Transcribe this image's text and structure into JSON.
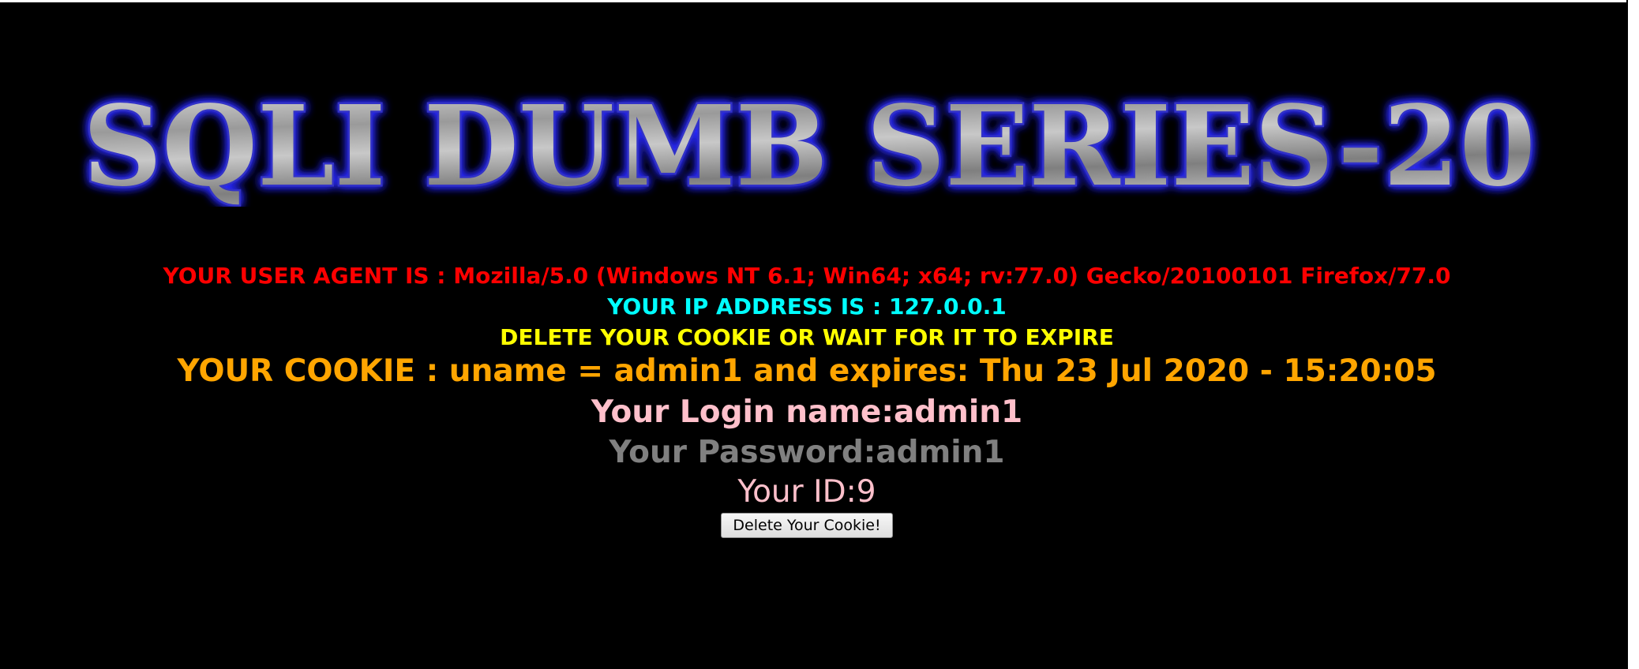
{
  "banner": {
    "title": "SQLI DUMB SERIES-20"
  },
  "info": {
    "user_agent": "YOUR USER AGENT IS : Mozilla/5.0 (Windows NT 6.1; Win64; x64; rv:77.0) Gecko/20100101 Firefox/77.0",
    "ip_address": "YOUR IP ADDRESS IS : 127.0.0.1",
    "delete_notice": "DELETE YOUR COOKIE OR WAIT FOR IT TO EXPIRE",
    "cookie": "YOUR COOKIE : uname = admin1 and expires: Thu 23 Jul 2020 - 15:20:05",
    "login_name": "Your Login name:admin1",
    "password": "Your Password:admin1",
    "id": "Your ID:9"
  },
  "actions": {
    "delete_cookie_label": "Delete Your Cookie!"
  },
  "colors": {
    "background": "#000000",
    "user_agent": "#ff0000",
    "ip_address": "#00ffff",
    "delete_notice": "#ffff00",
    "cookie": "#ffa500",
    "login_name": "#ffc0cb",
    "password": "#808080",
    "id": "#ffc0cb",
    "banner_glow": "#2a2aff"
  }
}
